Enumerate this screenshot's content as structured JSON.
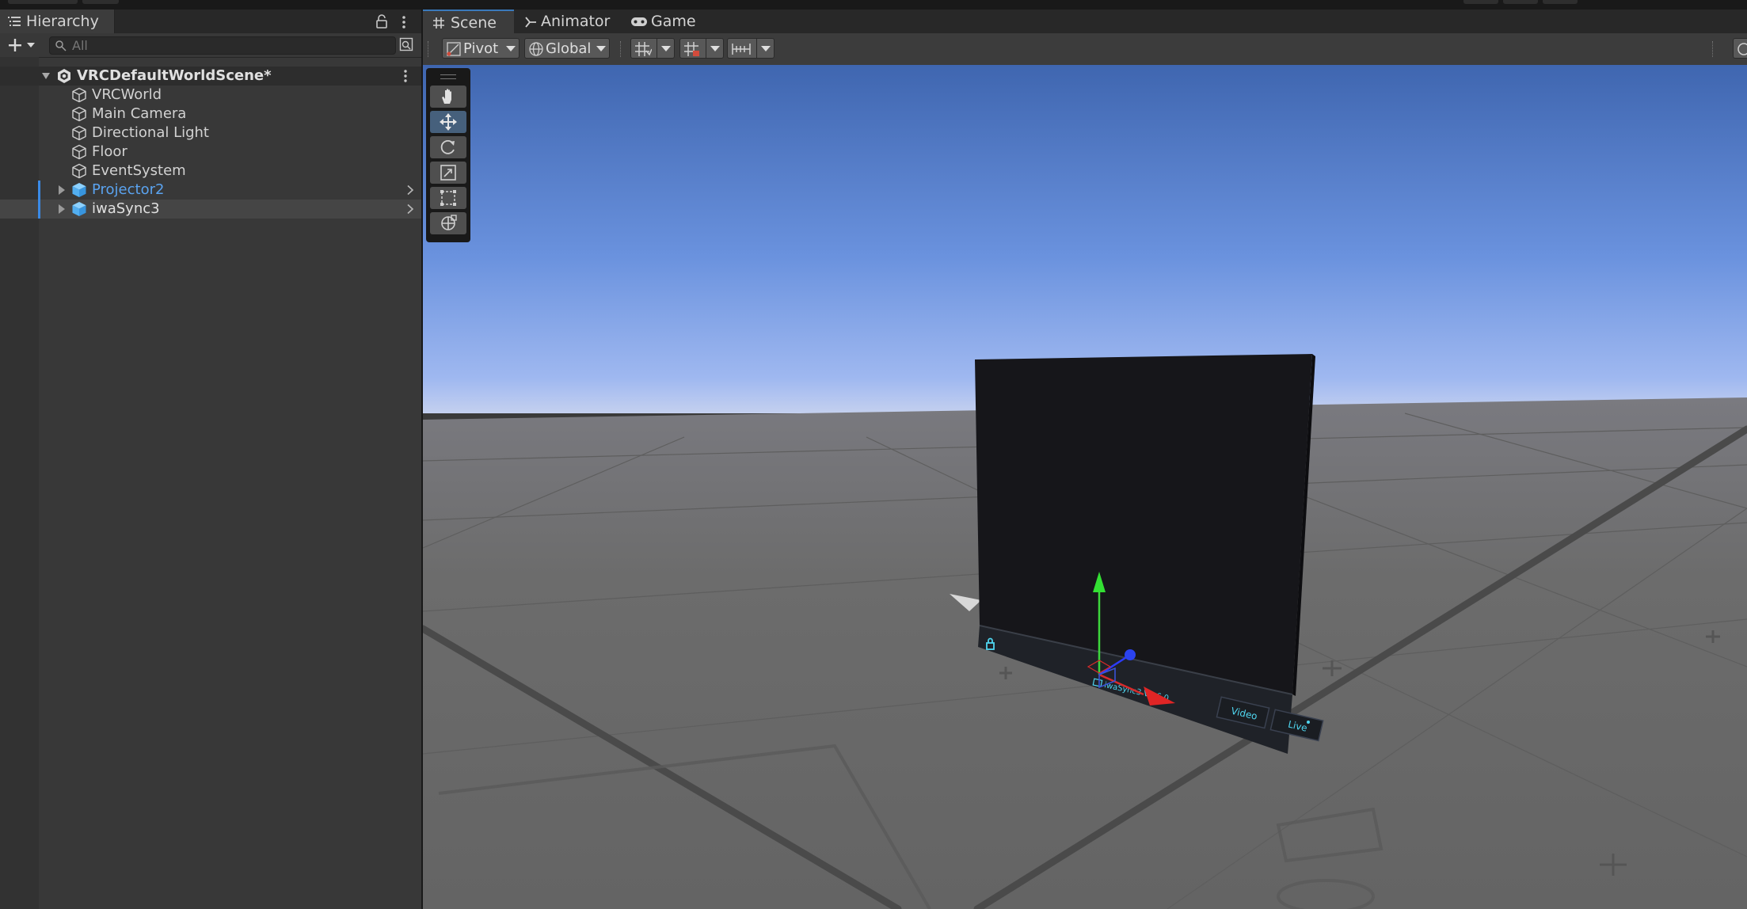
{
  "hierarchy": {
    "tab_label": "Hierarchy",
    "search_placeholder": "All",
    "scene_name": "VRCDefaultWorldScene*",
    "items": [
      {
        "label": "VRCWorld",
        "type": "gameobject"
      },
      {
        "label": "Main Camera",
        "type": "gameobject"
      },
      {
        "label": "Directional Light",
        "type": "gameobject"
      },
      {
        "label": "Floor",
        "type": "gameobject"
      },
      {
        "label": "EventSystem",
        "type": "gameobject"
      },
      {
        "label": "Projector2",
        "type": "prefab",
        "selected": true,
        "expandable": true
      },
      {
        "label": "iwaSync3",
        "type": "prefab",
        "hovered": true,
        "expandable": true
      }
    ]
  },
  "scene": {
    "tabs": [
      {
        "label": "Scene",
        "icon": "grid-icon",
        "active": true
      },
      {
        "label": "Animator",
        "icon": "animator-icon"
      },
      {
        "label": "Game",
        "icon": "gamepad-icon"
      }
    ],
    "toolbar": {
      "pivot_label": "Pivot",
      "global_label": "Global"
    },
    "tools": [
      "hand-tool-icon",
      "move-tool-icon",
      "rotate-tool-icon",
      "scale-tool-icon",
      "rect-tool-icon",
      "transform-tool-icon"
    ],
    "active_tool": "move-tool-icon",
    "object_label": "iwaSync3 V3.6.0",
    "video_button": "Video",
    "live_button": "Live"
  },
  "colors": {
    "panel": "#383838",
    "selection_text": "#5aa3f0",
    "accent": "#3a79bb",
    "sky_top": "#3f6bb6",
    "sky_horizon": "#b6c6ee",
    "floor": "#696969",
    "player_text": "#4fd6f0"
  }
}
